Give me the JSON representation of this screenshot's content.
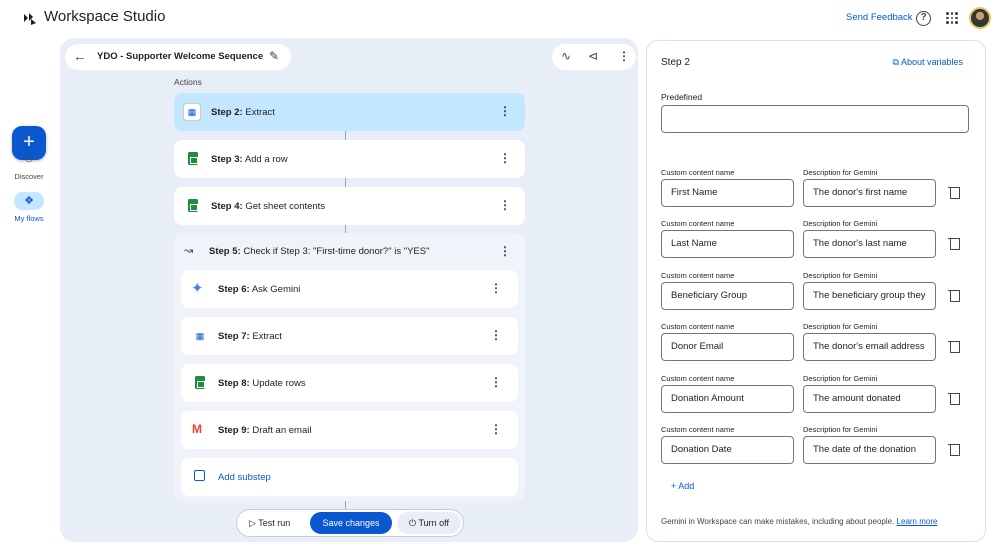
{
  "app": {
    "title": "Workspace Studio"
  },
  "header": {
    "send_feedback": "Send Feedback",
    "help_icon": "?"
  },
  "nav": {
    "fab_label": "+",
    "discover": "Discover",
    "my_flows": "My flows"
  },
  "flow": {
    "title": "YDO - Supporter Welcome Sequence",
    "actions_label": "Actions",
    "steps": [
      {
        "num": "Step 2:",
        "name": "Extract"
      },
      {
        "num": "Step 3:",
        "name": "Add a row"
      },
      {
        "num": "Step 4:",
        "name": "Get sheet contents"
      }
    ],
    "group": {
      "num": "Step 5:",
      "name": "Check if Step 3: \"First-time donor?\" is \"YES\"",
      "substeps": [
        {
          "num": "Step 6:",
          "name": "Ask Gemini"
        },
        {
          "num": "Step 7:",
          "name": "Extract"
        },
        {
          "num": "Step 8:",
          "name": "Update rows"
        },
        {
          "num": "Step 9:",
          "name": "Draft an email"
        }
      ],
      "add_substep": "Add substep"
    },
    "bottom": {
      "test_run": "Test run",
      "save_changes": "Save changes",
      "turn_off": "Turn off"
    }
  },
  "panel": {
    "title": "Step 2",
    "about_variables": "About variables",
    "predefined_label": "Predefined",
    "predefined_value": "",
    "name_label": "Custom content name",
    "desc_label": "Description for Gemini",
    "variables": [
      {
        "name": "First Name",
        "desc": "The donor's first name"
      },
      {
        "name": "Last Name",
        "desc": "The donor's last name"
      },
      {
        "name": "Beneficiary Group",
        "desc": "The beneficiary group they"
      },
      {
        "name": "Donor Email",
        "desc": "The donor's email address"
      },
      {
        "name": "Donation Amount",
        "desc": "The amount donated"
      },
      {
        "name": "Donation Date",
        "desc": "The date of the donation"
      }
    ],
    "add": "+ Add",
    "disclaimer": "Gemini in Workspace can make mistakes, including about people.",
    "learn_more": "Learn more"
  },
  "colors": {
    "accent": "#0b57d0",
    "canvas": "#e8eef7",
    "active_step": "#c2e7ff"
  }
}
